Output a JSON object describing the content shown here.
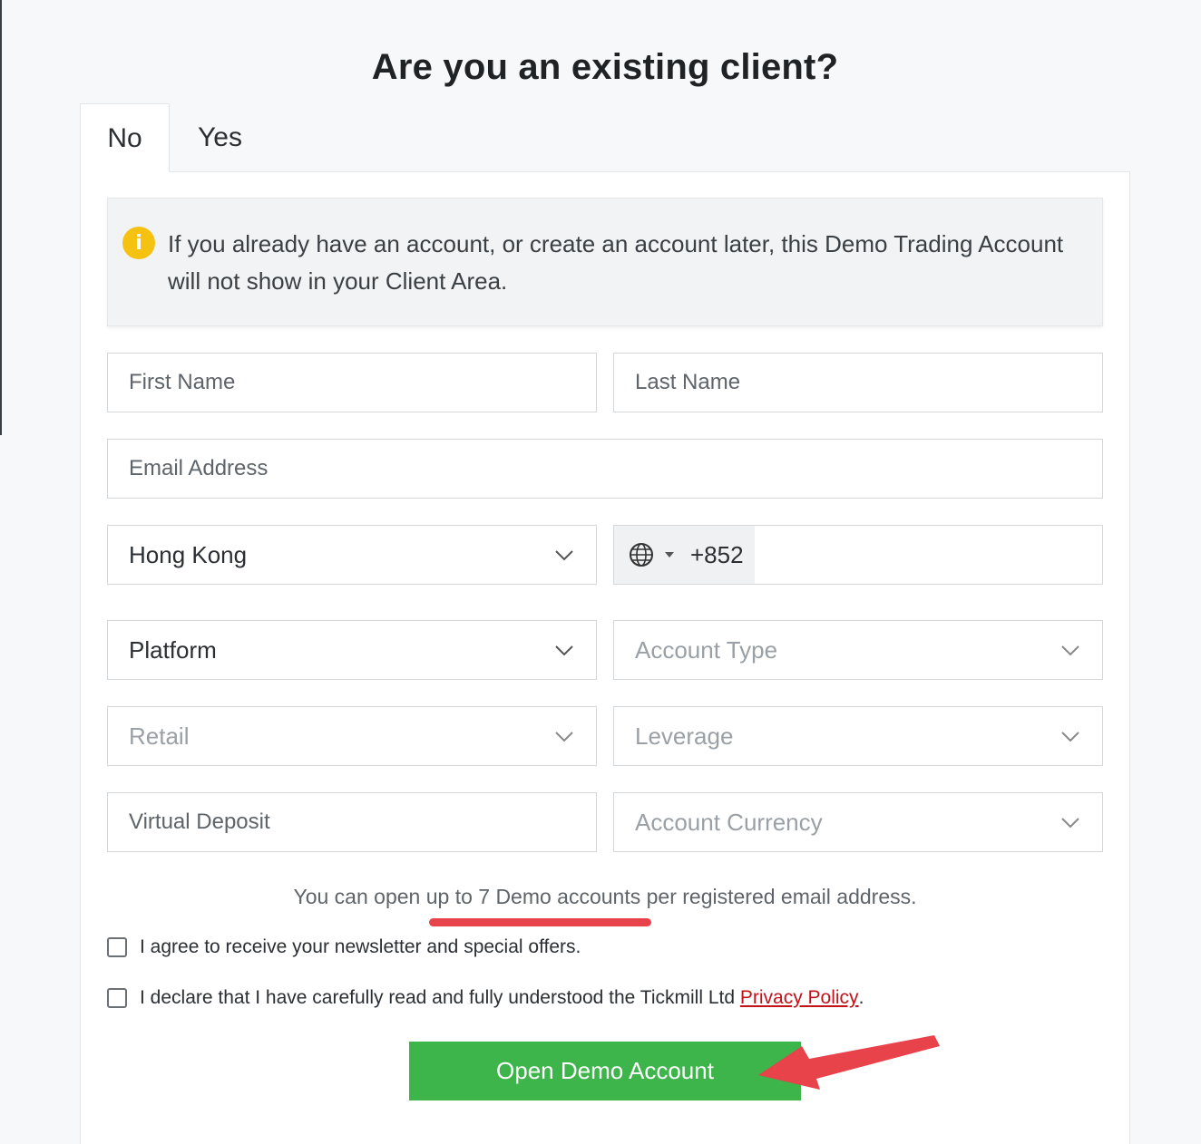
{
  "heading": "Are you an existing client?",
  "tabs": [
    {
      "label": "No",
      "active": true
    },
    {
      "label": "Yes",
      "active": false
    }
  ],
  "notice": {
    "icon": "info-icon",
    "text": "If you already have an account, or create an account later, this Demo Trading Account will not show in your Client Area."
  },
  "form": {
    "first_name_placeholder": "First Name",
    "last_name_placeholder": "Last Name",
    "email_placeholder": "Email Address",
    "country_value": "Hong Kong",
    "phone_code": "+852",
    "platform_value": "Platform",
    "account_type_placeholder": "Account Type",
    "retail_value": "Retail",
    "leverage_placeholder": "Leverage",
    "virtual_deposit_placeholder": "Virtual Deposit",
    "account_currency_placeholder": "Account Currency"
  },
  "limit_text": "You can open up to 7 Demo accounts per registered email address.",
  "checks": {
    "newsletter": "I agree to receive your newsletter and special offers.",
    "declare_prefix": "I declare that I have carefully read and fully understood the Tickmill Ltd ",
    "privacy_link": "Privacy Policy",
    "declare_suffix": "."
  },
  "submit_label": "Open Demo Account",
  "colors": {
    "accent_green": "#3db54a",
    "link_red": "#c4121a",
    "annotation_red": "#e8424a",
    "info_yellow": "#f5c211"
  }
}
